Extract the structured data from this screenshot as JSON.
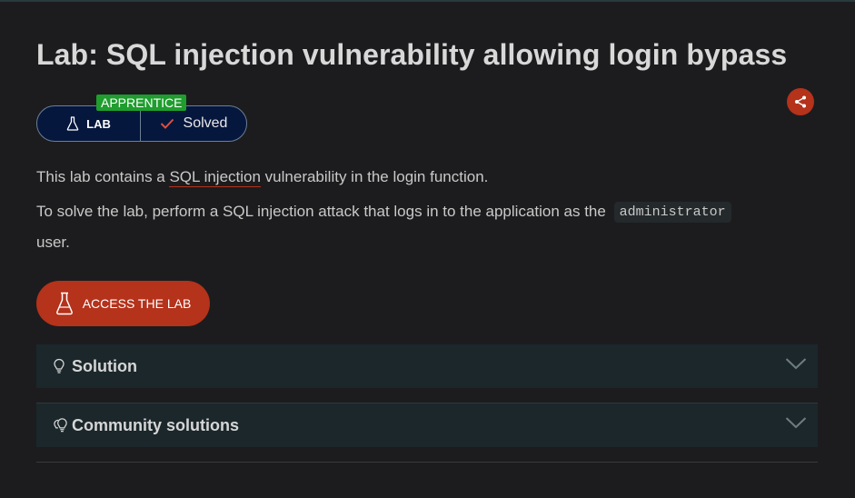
{
  "lab": {
    "title": "Lab: SQL injection vulnerability allowing login bypass",
    "level": "APPRENTICE",
    "type_label": "LAB",
    "status": "Solved"
  },
  "description": {
    "para1_prefix": "This lab contains a ",
    "para1_link": "SQL injection",
    "para1_suffix": " vulnerability in the login function.",
    "para2_text": "To solve the lab, perform a SQL injection attack that logs in to the application as the ",
    "para2_code": "administrator",
    "para3_text": "user."
  },
  "actions": {
    "access_label": "ACCESS THE LAB"
  },
  "accordions": {
    "solution_label": "Solution",
    "community_label": "Community solutions"
  },
  "icons": {
    "share": "share-icon",
    "flask": "flask-icon",
    "check": "check-icon",
    "lightbulb": "lightbulb-icon",
    "lightbulbs": "lightbulbs-icon",
    "chevron": "chevron-down-icon"
  },
  "colors": {
    "accent": "#b5321b",
    "badge_green": "#1f9d2e",
    "pill_bg": "#06173e",
    "panel_bg": "#1b272b",
    "page_bg": "#1c1c1e"
  }
}
